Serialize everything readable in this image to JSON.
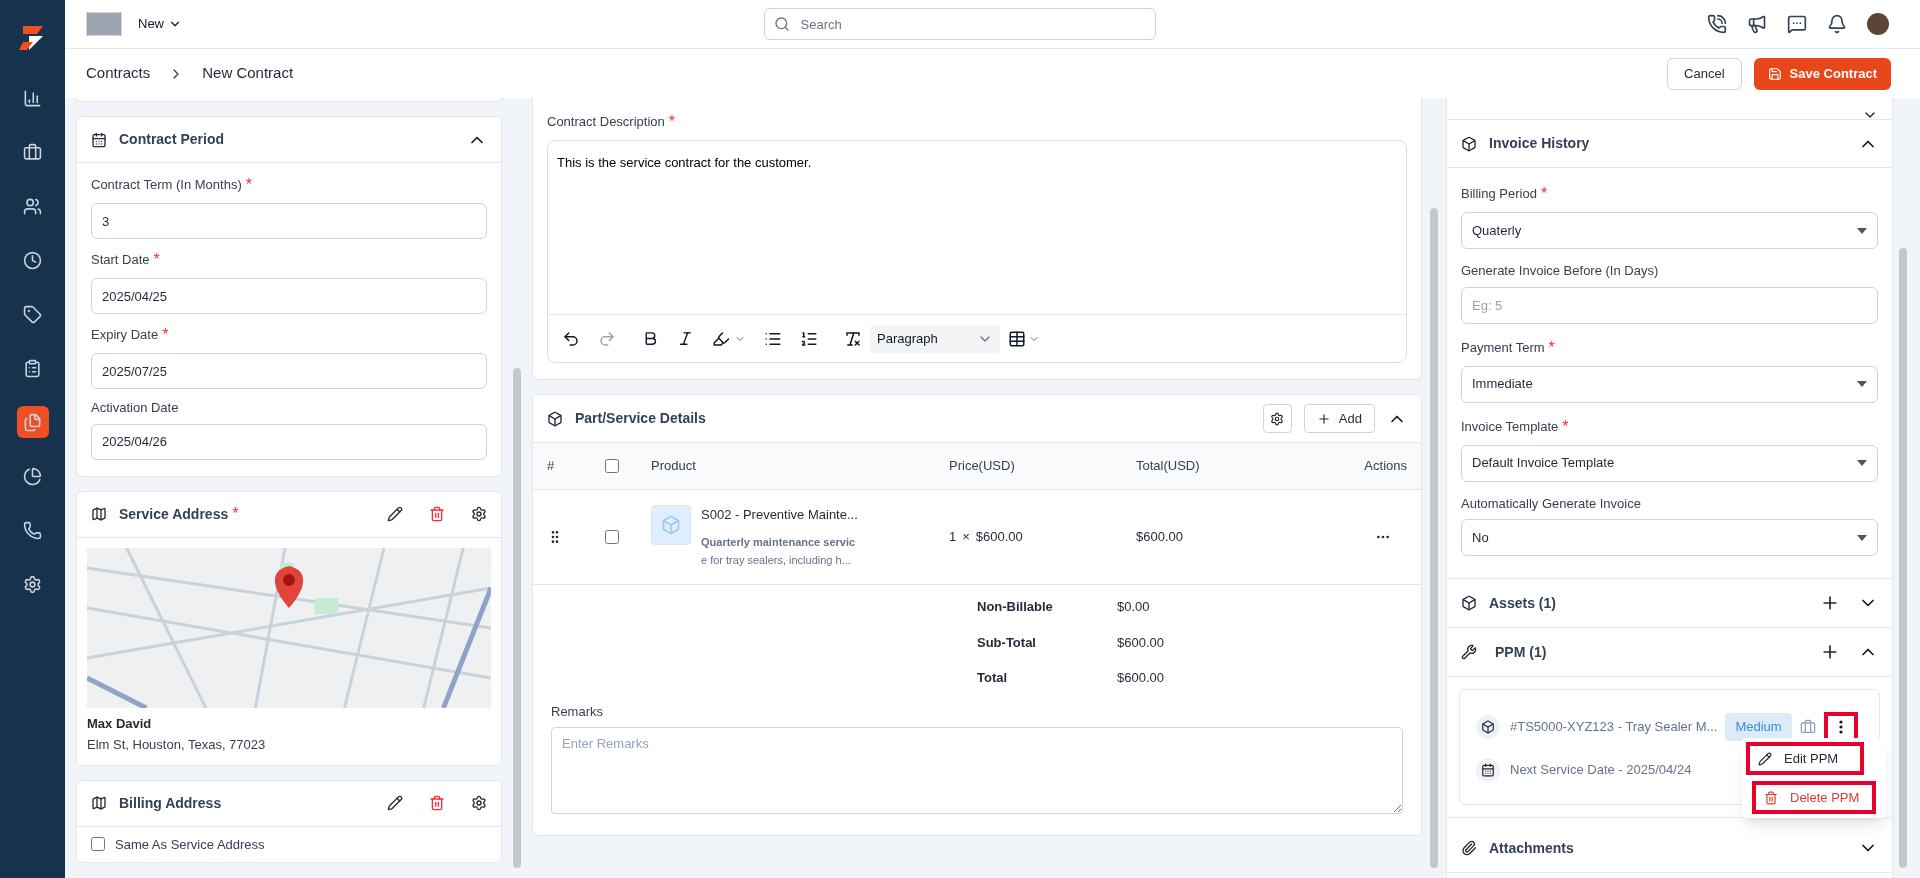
{
  "sidebar": {
    "items": [
      {
        "selected": false
      },
      {
        "selected": false
      },
      {
        "selected": false
      },
      {
        "selected": false
      },
      {
        "selected": false
      },
      {
        "selected": false
      },
      {
        "selected": true
      },
      {
        "selected": false
      },
      {
        "selected": false
      },
      {
        "selected": false
      }
    ]
  },
  "topbar": {
    "workspace": "New",
    "search": {
      "placeholder": "Search"
    }
  },
  "breadcrumb": [
    "Contracts",
    "New Contract"
  ],
  "actions": {
    "cancel": "Cancel",
    "save": "Save Contract"
  },
  "contract_period": {
    "title": "Contract Period",
    "expanded": true,
    "fields": [
      {
        "label": "Contract Term (In Months)",
        "mark": "*",
        "value": "3"
      },
      {
        "label": "Start Date",
        "mark": "*",
        "value": "2025/04/25"
      },
      {
        "label": "Expiry Date",
        "mark": "*",
        "value": "2025/07/25"
      },
      {
        "label": "Activation Date",
        "value": "2025/04/26"
      }
    ]
  },
  "service_address": {
    "title": "Service Address",
    "mark": "*",
    "name": "Max David",
    "address": "Elm St, Houston, Texas, 77023"
  },
  "billing_address": {
    "title": "Billing Address",
    "same_as_service": {
      "label": "Same As Service Address",
      "checked": false
    }
  },
  "description": {
    "label": "Contract Description",
    "mark": "*",
    "value": "This is the service contract for the customer.",
    "block_format": "Paragraph"
  },
  "parts": {
    "title": "Part/Service Details",
    "add": "Add",
    "expanded": true,
    "select_all_checked": false,
    "columns": [
      "#",
      "Product",
      "Price(USD)",
      "Total(USD)",
      "Actions"
    ],
    "rows": [
      {
        "checked": false,
        "name": "S002 - Preventive Mainte...",
        "description": "**Quarterly maintenance servic**e for tray sealers, including h...",
        "qty": "1",
        "multiply": "×",
        "price": "$600.00",
        "total": "$600.00"
      }
    ],
    "summary": [
      {
        "label": "Non-Billable",
        "value": "$0.00"
      },
      {
        "label": "Sub-Total",
        "value": "$600.00"
      },
      {
        "label": "Total",
        "value": "$600.00"
      }
    ],
    "remarks": {
      "label": "Remarks",
      "placeholder": "Enter Remarks"
    }
  },
  "invoice_history": {
    "title": "Invoice History",
    "expanded": true,
    "fields": [
      {
        "kind": "select",
        "label": "Billing Period",
        "mark": "*",
        "value": "Quaterly"
      },
      {
        "kind": "input",
        "label": "Generate Invoice Before (In Days)",
        "placeholder": "Eg: 5"
      },
      {
        "kind": "select",
        "label": "Payment Term",
        "mark": "*",
        "value": "Immediate"
      },
      {
        "kind": "select",
        "label": "Invoice Template",
        "mark": "*",
        "value": "Default Invoice Template"
      },
      {
        "kind": "select",
        "label": "Automatically Generate Invoice",
        "value": "No"
      }
    ]
  },
  "assets": {
    "title": "Assets (1)",
    "expanded": false
  },
  "ppm": {
    "title": "PPM (1)",
    "expanded": true,
    "item": {
      "asset": "#TS5000-XYZ123 - Tray Sealer M...",
      "priority": "Medium",
      "next_service": "Next Service Date - 2025/04/24"
    },
    "menu_highlighted": true,
    "menu": [
      {
        "kind": "edit",
        "label": "Edit PPM",
        "highlighted": true
      },
      {
        "kind": "delete",
        "label": "Delete PPM",
        "highlighted": true
      }
    ]
  },
  "attachments": {
    "title": "Attachments",
    "expanded": false
  }
}
